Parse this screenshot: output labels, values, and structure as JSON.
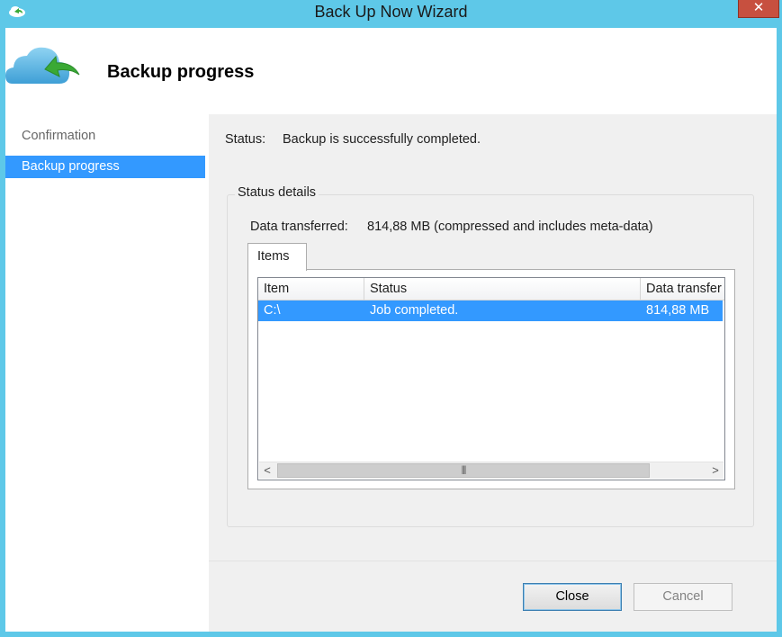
{
  "window": {
    "title": "Back Up Now Wizard",
    "close_glyph": "✕"
  },
  "header": {
    "title": "Backup progress",
    "icon": "cloud-backup-icon"
  },
  "nav": {
    "items": [
      {
        "label": "Confirmation",
        "selected": false
      },
      {
        "label": "Backup progress",
        "selected": true
      }
    ]
  },
  "status": {
    "label": "Status:",
    "value": "Backup is successfully completed."
  },
  "details": {
    "group_title": "Status details",
    "data_label": "Data transferred:",
    "data_value": "814,88 MB (compressed and includes meta-data)",
    "tab_label": "Items",
    "columns": [
      "Item",
      "Status",
      "Data transfer"
    ],
    "rows": [
      {
        "item": "C:\\",
        "status": "Job completed.",
        "data": "814,88 MB"
      }
    ]
  },
  "scrollbar": {
    "left_arrow": "<",
    "right_arrow": ">",
    "grip": "|||"
  },
  "buttons": {
    "close_label": "Close",
    "cancel_label": "Cancel"
  },
  "colors": {
    "frame": "#5ec8e8",
    "selection": "#3399ff",
    "icon_cloud": "#5ab4e0",
    "icon_arrow": "#3aa935"
  }
}
